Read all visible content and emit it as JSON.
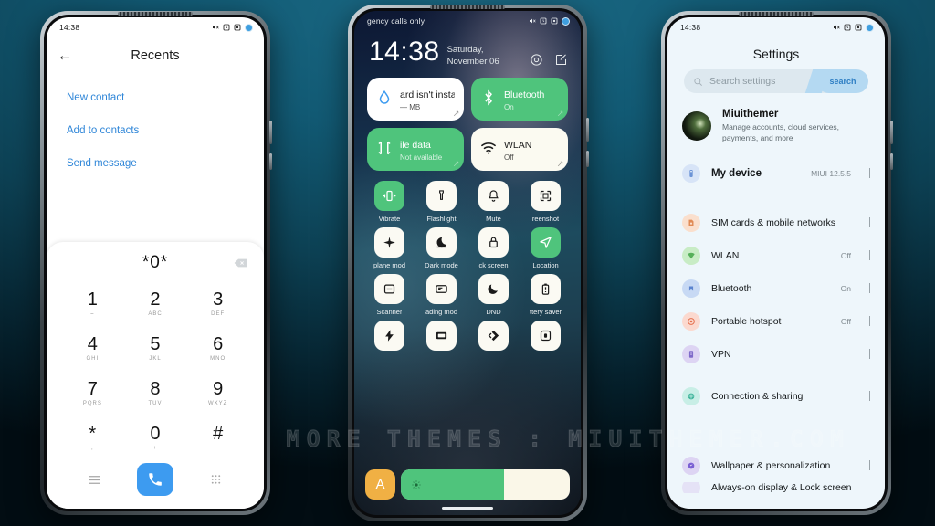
{
  "background": {
    "color_top": "#1b6a85",
    "color_bottom": "#020d13"
  },
  "watermark": {
    "text": "VISIT FOR MORE THEMES : MIUITHEMER.COM"
  },
  "phone_left": {
    "name": "dialer-phone",
    "statusbar": {
      "time": "14:38",
      "icons": [
        "mute-icon",
        "alarm-icon",
        "screenshot-icon",
        "battery-circle-icon"
      ]
    },
    "header": {
      "back": "←",
      "title": "Recents"
    },
    "links": [
      {
        "label": "New contact"
      },
      {
        "label": "Add to contacts"
      },
      {
        "label": "Send message"
      }
    ],
    "dialpad": {
      "number": "*0*",
      "keys": [
        {
          "num": "1",
          "sub": "⌣"
        },
        {
          "num": "2",
          "sub": "ABC"
        },
        {
          "num": "3",
          "sub": "DEF"
        },
        {
          "num": "4",
          "sub": "GHI"
        },
        {
          "num": "5",
          "sub": "JKL"
        },
        {
          "num": "6",
          "sub": "MNO"
        },
        {
          "num": "7",
          "sub": "PQRS"
        },
        {
          "num": "8",
          "sub": "TUV"
        },
        {
          "num": "9",
          "sub": "WXYZ"
        },
        {
          "num": "*",
          "sub": ","
        },
        {
          "num": "0",
          "sub": "+"
        },
        {
          "num": "#",
          "sub": ""
        }
      ],
      "actions": {
        "menu": "menu-icon",
        "call": "call-icon",
        "keypad": "keypad-icon"
      },
      "accent": "#3d9bf0"
    }
  },
  "phone_center": {
    "name": "control-center-phone",
    "statusbar": {
      "carrier": "gency calls only",
      "icons": [
        "mute-icon",
        "alarm-icon",
        "screenshot-icon",
        "battery-circle-icon"
      ]
    },
    "clock": {
      "time": "14:38",
      "date": "Saturday, November 06"
    },
    "header_actions": [
      "settings-gear-icon",
      "edit-icon"
    ],
    "cards": [
      {
        "title": "ard isn't instal",
        "subtitle": "— MB",
        "state": "light",
        "icon": "data-drop-icon"
      },
      {
        "title": "Bluetooth",
        "subtitle": "On",
        "state": "green",
        "icon": "bluetooth-icon"
      },
      {
        "title": "ile data",
        "subtitle": "Not available",
        "state": "green",
        "icon": "mobile-data-icon"
      },
      {
        "title": "WLAN",
        "subtitle": "Off",
        "state": "light",
        "icon": "wifi-icon"
      }
    ],
    "tiles": [
      {
        "label": "Vibrate",
        "icon": "vibrate-icon",
        "on": true
      },
      {
        "label": "Flashlight",
        "icon": "flashlight-icon",
        "on": false
      },
      {
        "label": "Mute",
        "icon": "bell-icon",
        "on": false
      },
      {
        "label": "reenshot",
        "icon": "screenshot-icon",
        "on": false
      },
      {
        "label": "plane mod",
        "icon": "airplane-icon",
        "on": false
      },
      {
        "label": "Dark mode",
        "icon": "dark-mode-icon",
        "on": false
      },
      {
        "label": "ck screen",
        "icon": "lock-icon",
        "on": false
      },
      {
        "label": "Location",
        "icon": "location-icon",
        "on": true
      },
      {
        "label": "Scanner",
        "icon": "scanner-icon",
        "on": false
      },
      {
        "label": "ading mod",
        "icon": "reading-mode-icon",
        "on": false
      },
      {
        "label": "DND",
        "icon": "moon-icon",
        "on": false
      },
      {
        "label": "ttery saver",
        "icon": "battery-saver-icon",
        "on": false
      },
      {
        "label": "",
        "icon": "ultra-battery-icon",
        "on": false
      },
      {
        "label": "",
        "icon": "cast-icon",
        "on": false
      },
      {
        "label": "",
        "icon": "nfc-icon",
        "on": false
      },
      {
        "label": "",
        "icon": "second-space-icon",
        "on": false
      }
    ],
    "brightness": {
      "auto_label": "A",
      "level_percent": 61,
      "icon": "sun-icon"
    },
    "accent_on": "#4fc47c",
    "accent_auto": "#f0b044"
  },
  "phone_right": {
    "name": "settings-phone",
    "statusbar": {
      "time": "14:38",
      "icons": [
        "mute-icon",
        "alarm-icon",
        "screenshot-icon",
        "battery-circle-icon"
      ]
    },
    "title": "Settings",
    "search": {
      "placeholder": "Search settings",
      "button_label": "search",
      "icon": "search-icon"
    },
    "account": {
      "name": "Miuithemer",
      "description": "Manage accounts, cloud services, payments, and more"
    },
    "rows": [
      {
        "label": "My device",
        "value": "MIUI 12.5.5",
        "icon": "device-icon",
        "icon_bg": "#d7e4f7",
        "icon_fg": "#6b93d6",
        "bold": true
      },
      {
        "label": "SIM cards & mobile networks",
        "value": "",
        "icon": "sim-icon",
        "icon_bg": "#fadfcd",
        "icon_fg": "#e08a55"
      },
      {
        "label": "WLAN",
        "value": "Off",
        "icon": "wlan-icon",
        "icon_bg": "#c8ecc5",
        "icon_fg": "#56b05a"
      },
      {
        "label": "Bluetooth",
        "value": "On",
        "icon": "bluetooth-icon",
        "icon_bg": "#c7d9f4",
        "icon_fg": "#5b84cf"
      },
      {
        "label": "Portable hotspot",
        "value": "Off",
        "icon": "hotspot-icon",
        "icon_bg": "#fbd9cf",
        "icon_fg": "#e4714f"
      },
      {
        "label": "VPN",
        "value": "",
        "icon": "vpn-icon",
        "icon_bg": "#ddd4f3",
        "icon_fg": "#7f6ac9"
      },
      {
        "label": "Connection & sharing",
        "value": "",
        "icon": "connection-icon",
        "icon_bg": "#c8eee6",
        "icon_fg": "#3fb49b"
      },
      {
        "label": "Wallpaper & personalization",
        "value": "",
        "icon": "wallpaper-icon",
        "icon_bg": "#ddd4f3",
        "icon_fg": "#7a5fd3"
      }
    ],
    "partial_row": {
      "label": "Always-on display & Lock screen"
    }
  }
}
